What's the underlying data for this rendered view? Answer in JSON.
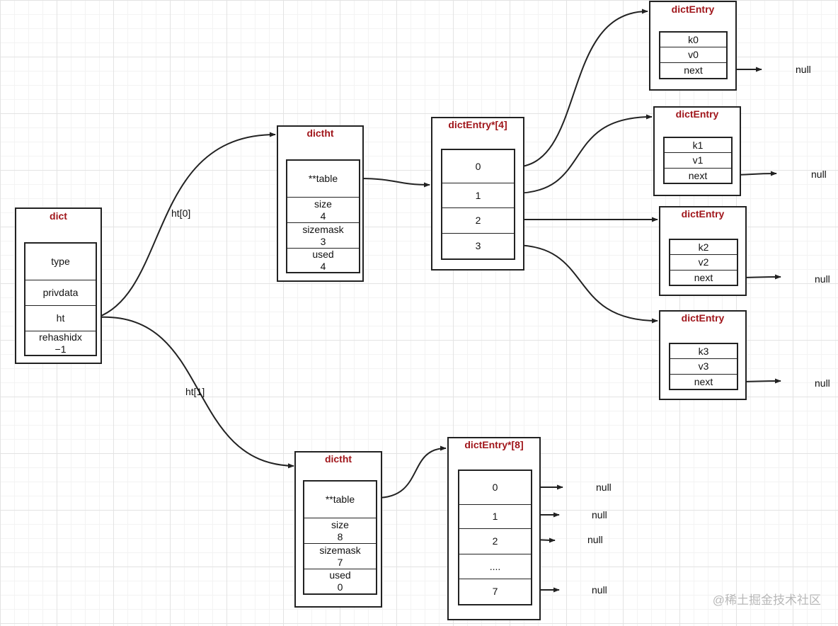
{
  "dict": {
    "title": "dict",
    "fields": [
      "type",
      "privdata",
      "ht"
    ],
    "rehashidx": {
      "name": "rehashidx",
      "value": "−1"
    }
  },
  "edge_labels": {
    "ht0": "ht[0]",
    "ht1": "ht[1]"
  },
  "ht0": {
    "title": "dictht",
    "table": "**table",
    "size": {
      "name": "size",
      "value": "4"
    },
    "sizemask": {
      "name": "sizemask",
      "value": "3"
    },
    "used": {
      "name": "used",
      "value": "4"
    }
  },
  "ht1": {
    "title": "dictht",
    "table": "**table",
    "size": {
      "name": "size",
      "value": "8"
    },
    "sizemask": {
      "name": "sizemask",
      "value": "7"
    },
    "used": {
      "name": "used",
      "value": "0"
    }
  },
  "buckets4": {
    "title": "dictEntry*[4]",
    "slots": [
      "0",
      "1",
      "2",
      "3"
    ]
  },
  "buckets8": {
    "title": "dictEntry*[8]",
    "slots": [
      "0",
      "1",
      "2",
      "....",
      "7"
    ]
  },
  "entries": [
    {
      "title": "dictEntry",
      "key": "k0",
      "value": "v0",
      "next": "next",
      "next_target": "null"
    },
    {
      "title": "dictEntry",
      "key": "k1",
      "value": "v1",
      "next": "next",
      "next_target": "null"
    },
    {
      "title": "dictEntry",
      "key": "k2",
      "value": "v2",
      "next": "next",
      "next_target": "null"
    },
    {
      "title": "dictEntry",
      "key": "k3",
      "value": "v3",
      "next": "next",
      "next_target": "null"
    }
  ],
  "buckets8_nulls": [
    "null",
    "null",
    "null",
    "null"
  ],
  "watermark": "@稀土掘金技术社区",
  "colors": {
    "title": "#a0161b",
    "stroke": "#222222"
  }
}
